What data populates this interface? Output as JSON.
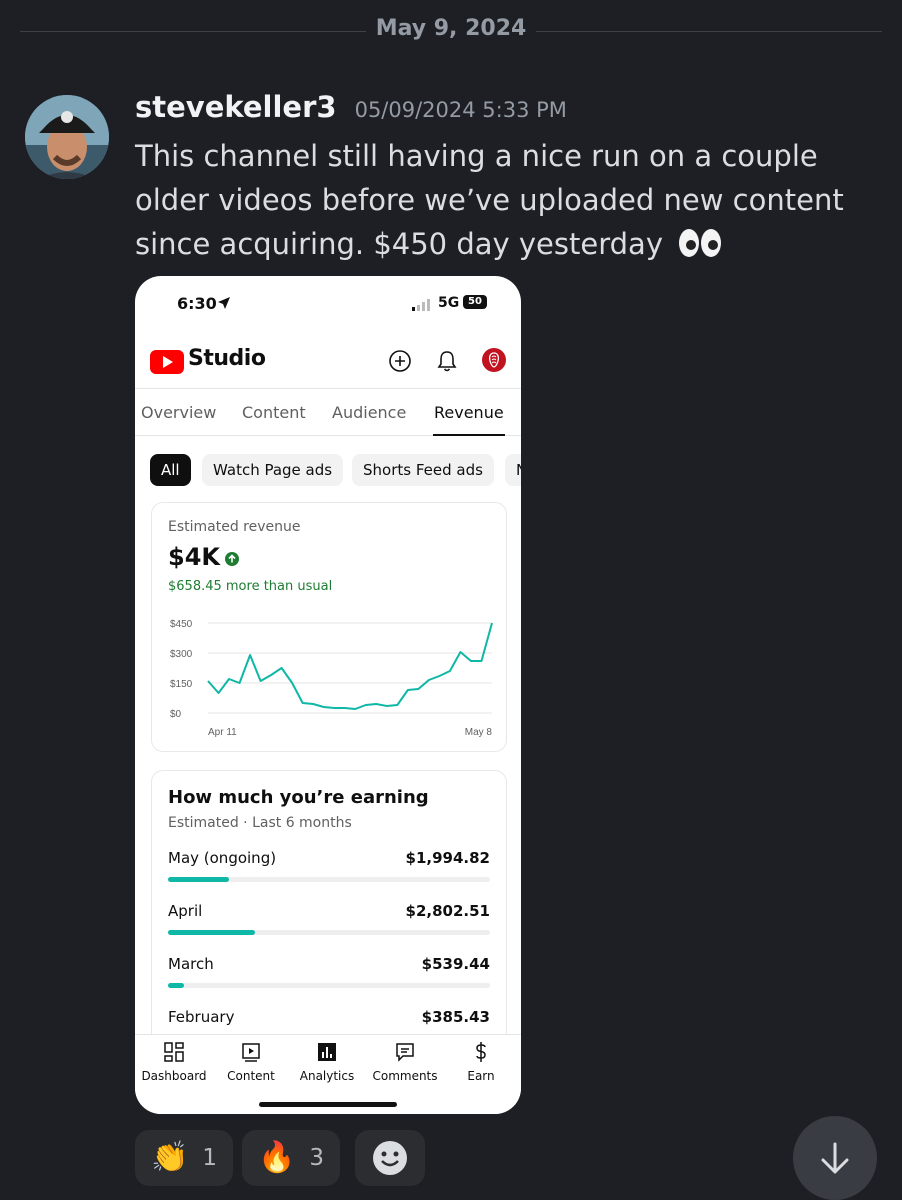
{
  "divider": {
    "date": "May 9, 2024"
  },
  "message": {
    "username": "stevekeller3",
    "timestamp": "05/09/2024 5:33 PM",
    "text": "This channel still having a nice run on a couple older videos before we’ve uploaded new content since acquiring. $450 day yesterday",
    "trailing_emoji": "eyes-emoji"
  },
  "phone": {
    "status": {
      "time": "6:30",
      "network": "5G",
      "battery": "50"
    },
    "app_title": "Studio",
    "tabs": [
      {
        "label": "Overview",
        "active": false
      },
      {
        "label": "Content",
        "active": false
      },
      {
        "label": "Audience",
        "active": false
      },
      {
        "label": "Revenue",
        "active": true
      }
    ],
    "chips": [
      {
        "label": "All",
        "active": true
      },
      {
        "label": "Watch Page ads",
        "active": false
      },
      {
        "label": "Shorts Feed ads",
        "active": false
      },
      {
        "label": "N",
        "active": false
      }
    ],
    "revenue_card": {
      "label": "Estimated revenue",
      "value": "$4K",
      "delta_text": "$658.45 more than usual",
      "accent": "#0fb7a7"
    },
    "earnings_card": {
      "title": "How much you’re earning",
      "subtitle": "Estimated · Last 6 months",
      "rows": [
        {
          "month": "May (ongoing)",
          "amount": "$1,994.82",
          "share": 0.19
        },
        {
          "month": "April",
          "amount": "$2,802.51",
          "share": 0.27
        },
        {
          "month": "March",
          "amount": "$539.44",
          "share": 0.05
        },
        {
          "month": "February",
          "amount": "$385.43",
          "share": 0
        }
      ]
    },
    "bottom_nav": [
      {
        "label": "Dashboard",
        "icon": "dashboard-icon"
      },
      {
        "label": "Content",
        "icon": "content-icon"
      },
      {
        "label": "Analytics",
        "icon": "analytics-icon"
      },
      {
        "label": "Comments",
        "icon": "comments-icon"
      },
      {
        "label": "Earn",
        "icon": "earn-icon"
      }
    ]
  },
  "reactions": [
    {
      "emoji": "👏",
      "count": "1"
    },
    {
      "emoji": "🔥",
      "count": "3"
    }
  ],
  "chart_data": {
    "type": "line",
    "title": "",
    "xlabel": "",
    "ylabel": "",
    "x_tick_labels": [
      "Apr 11",
      "May 8"
    ],
    "y_tick_labels": [
      "$450",
      "$300",
      "$150",
      "$0"
    ],
    "ylim": [
      0,
      450
    ],
    "grid": true,
    "series": [
      {
        "values": [
          160,
          100,
          170,
          150,
          290,
          160,
          190,
          225,
          150,
          50,
          45,
          30,
          25,
          25,
          20,
          40,
          45,
          35,
          40,
          115,
          120,
          165,
          185,
          210,
          305,
          260,
          260,
          450
        ]
      }
    ]
  }
}
